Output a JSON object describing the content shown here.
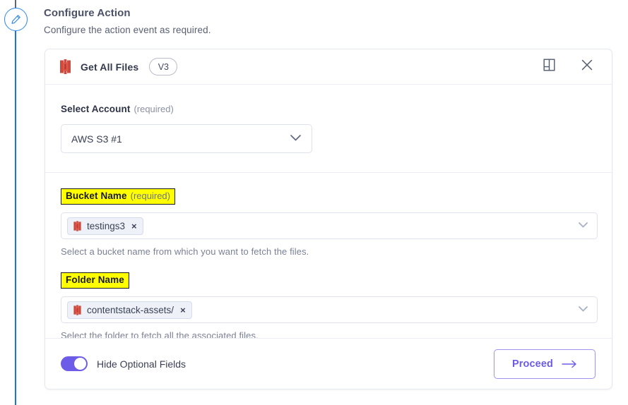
{
  "rail": {
    "edit_icon": "pencil-edit-icon"
  },
  "header": {
    "title": "Configure Action",
    "subtitle": "Configure the action event as required."
  },
  "card": {
    "app_icon": "aws-s3-bucket-icon",
    "title": "Get All Files",
    "version_badge": "V3",
    "docs_icon": "book-icon",
    "close_icon": "close-icon"
  },
  "account": {
    "label": "Select Account",
    "required": "(required)",
    "selected": "AWS S3 #1",
    "chevron_icon": "chevron-down-icon"
  },
  "bucket": {
    "label": "Bucket Name",
    "required": "(required)",
    "chip_icon": "aws-s3-bucket-icon",
    "chip_value": "testings3",
    "chip_remove": "×",
    "help": "Select a bucket name from which you want to fetch the files.",
    "chevron_icon": "chevron-down-icon",
    "highlighted": true
  },
  "folder": {
    "label": "Folder Name",
    "required": "",
    "chip_icon": "aws-s3-bucket-icon",
    "chip_value": "contentstack-assets/",
    "chip_remove": "×",
    "help": "Select the folder to fetch all the associated files.",
    "chevron_icon": "chevron-down-icon",
    "highlighted": true
  },
  "footer": {
    "toggle_label": "Hide Optional Fields",
    "toggle_on": true,
    "proceed_label": "Proceed",
    "proceed_arrow_icon": "arrow-right-icon"
  },
  "colors": {
    "accent_purple": "#6c5ce7",
    "rail_blue": "#1675e0",
    "highlight_yellow": "#ffff00",
    "s3_red": "#c9302c",
    "text_dark": "#2d3346",
    "text_muted": "#7a8196"
  }
}
